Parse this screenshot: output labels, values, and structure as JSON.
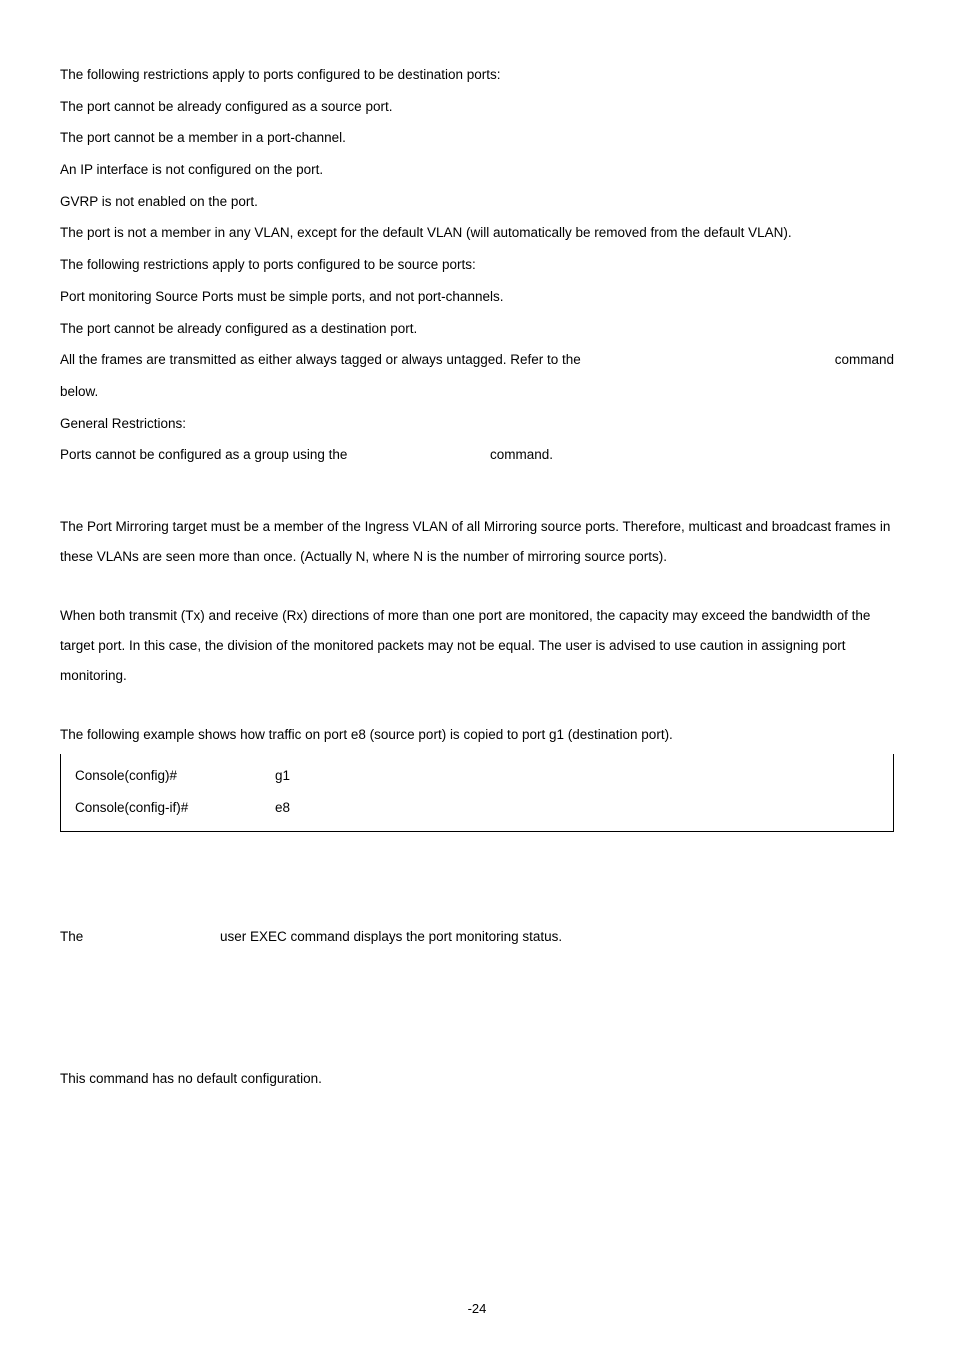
{
  "p1": "The following restrictions apply to ports configured to be destination ports:",
  "p2": "The port cannot be already configured as a source port.",
  "p3": "The port cannot be a member in a port-channel.",
  "p4": "An IP interface is not configured on the port.",
  "p5": "GVRP is not enabled on the port.",
  "p6": "The port is not a member in any VLAN, except for the default VLAN (will automatically be removed from the default VLAN).",
  "p7": "The following restrictions apply to ports configured to be source ports:",
  "p8": "Port monitoring Source Ports must be simple ports, and not port-channels.",
  "p9": "The port cannot be already configured as a destination port.",
  "p10_left": "All the frames are transmitted as either always tagged or always untagged. Refer to the",
  "p10_right": "command",
  "p10_below": "below.",
  "p11": "General Restrictions:",
  "p12_left": "Ports cannot be configured as a group using the",
  "p12_right": "command.",
  "p13": "The Port Mirroring target must be a member of the Ingress VLAN of all Mirroring source ports. Therefore, multicast and broadcast frames in these VLANs are seen more than once. (Actually N, where N is the number of mirroring source ports).",
  "p14": "When both transmit (Tx) and receive (Rx) directions of more than one port are monitored, the capacity may exceed the bandwidth of the target port. In this case, the division of the monitored packets may not be equal. The user is advised to use caution in assigning port monitoring.",
  "p15": "The following example shows how traffic on port e8 (source port) is copied to port g1 (destination port).",
  "code": {
    "row1_prompt": "Console(config)#",
    "row1_arg": "g1",
    "row2_prompt": "Console(config-if)#",
    "row2_arg": "e8"
  },
  "p16_the": "The",
  "p16_rest": "user EXEC command displays the port monitoring status.",
  "p17": "This command has no default configuration.",
  "page_number": "-24"
}
